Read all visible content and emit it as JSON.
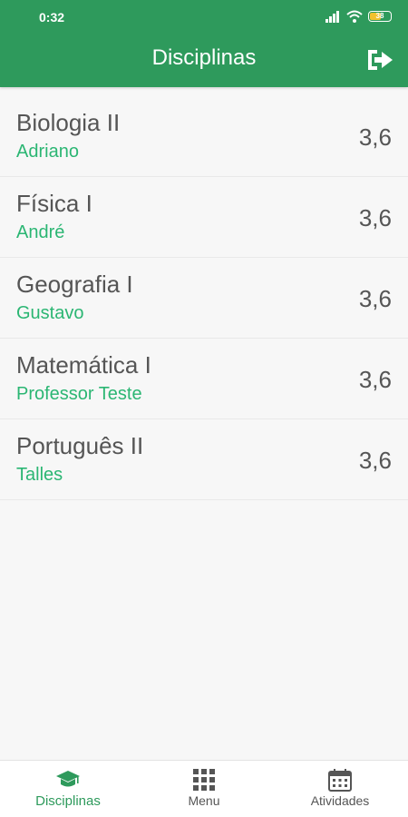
{
  "status_bar": {
    "time": "0:32",
    "battery_level": "38",
    "icons": [
      "signal-icon",
      "wifi-icon",
      "battery-icon"
    ]
  },
  "app_bar": {
    "title": "Disciplinas",
    "action_icon": "logout-icon"
  },
  "subjects": [
    {
      "name": "Biologia II",
      "teacher": "Adriano",
      "grade": "3,6"
    },
    {
      "name": "Física I",
      "teacher": "André",
      "grade": "3,6"
    },
    {
      "name": "Geografia I",
      "teacher": "Gustavo",
      "grade": "3,6"
    },
    {
      "name": "Matemática I",
      "teacher": "Professor Teste",
      "grade": "3,6"
    },
    {
      "name": "Português II",
      "teacher": "Talles",
      "grade": "3,6"
    }
  ],
  "bottom_nav": {
    "items": [
      {
        "label": "Disciplinas",
        "icon": "graduation-cap-icon",
        "active": true
      },
      {
        "label": "Menu",
        "icon": "grid-icon",
        "active": false
      },
      {
        "label": "Atividades",
        "icon": "calendar-icon",
        "active": false
      }
    ]
  },
  "colors": {
    "primary": "#2e9a5c",
    "accent_text": "#2bb673",
    "body_text": "#555555",
    "background": "#f7f7f7"
  }
}
